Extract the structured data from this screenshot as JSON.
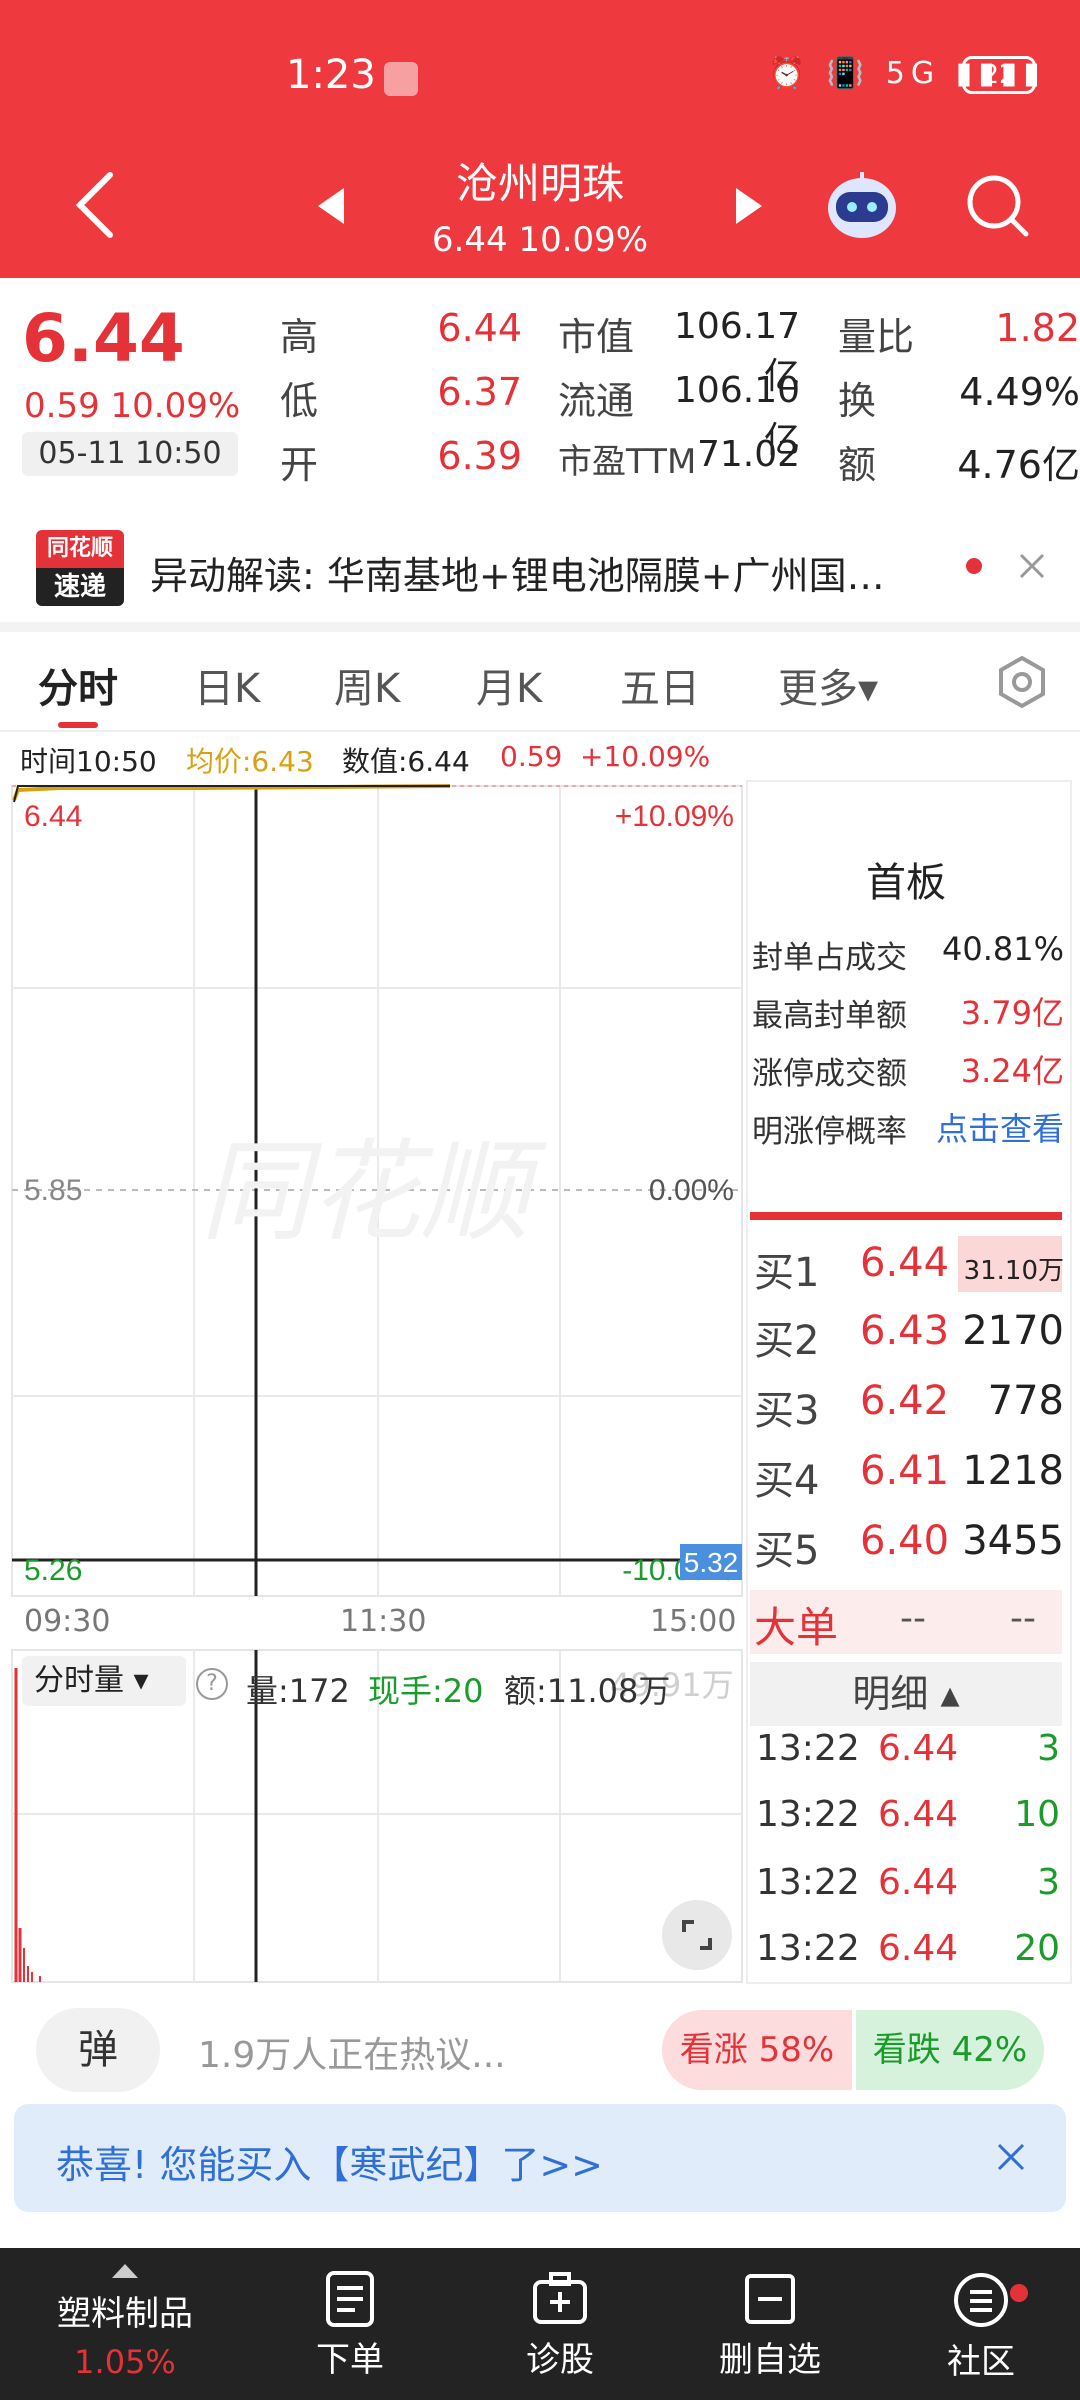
{
  "status_bar": {
    "time": "1:23",
    "icons": "⏰ 📳 5G ▮▮▮▮",
    "battery": "22"
  },
  "header": {
    "title": "沧州明珠",
    "subtitle": "6.44 10.09%"
  },
  "quote": {
    "price": "6.44",
    "change": "0.59  10.09%",
    "time": "05-11 10:50",
    "stats": [
      {
        "label": "高",
        "value": "6.44"
      },
      {
        "label": "低",
        "value": "6.37"
      },
      {
        "label": "开",
        "value": "6.39"
      },
      {
        "label": "市值",
        "value": "106.17亿"
      },
      {
        "label": "流通",
        "value": "106.10亿"
      },
      {
        "label": "市盈TTM",
        "value": "71.02"
      },
      {
        "label": "量比",
        "value": "1.82"
      },
      {
        "label": "换",
        "value": "4.49%"
      },
      {
        "label": "额",
        "value": "4.76亿"
      }
    ]
  },
  "news": {
    "logo_top": "同花顺",
    "logo_bottom": "速递",
    "text": "异动解读:  华南基地+锂电池隔膜+广州国…"
  },
  "tabs": [
    "分时",
    "日K",
    "周K",
    "月K",
    "五日",
    "更多▾"
  ],
  "chart_info": {
    "time": "时间10:50",
    "avg": "均价:6.43",
    "value": "数值:6.44",
    "chg": "0.59",
    "pct": "+10.09%"
  },
  "chart": {
    "y_top": "6.44",
    "y_mid": "5.85",
    "y_bot": "5.26",
    "pct_top": "+10.09%",
    "pct_mid": "0.00%",
    "pct_bot": "-10.09%",
    "price_marker": "5.32",
    "x_labels": [
      "09:30",
      "11:30",
      "15:00"
    ],
    "watermark": "同花顺"
  },
  "volume": {
    "selector": "分时量 ▾",
    "vol": "量:172",
    "now": "现手:20",
    "amt": "额:11.08万",
    "ghost": "49.91万"
  },
  "order_panel": {
    "title": "首板",
    "metrics": [
      {
        "label": "封单占成交",
        "value": "40.81%"
      },
      {
        "label": "最高封单额",
        "value": "3.79亿"
      },
      {
        "label": "涨停成交额",
        "value": "3.24亿"
      },
      {
        "label": "明涨停概率",
        "value": "点击查看"
      }
    ],
    "bids": [
      {
        "label": "买1",
        "price": "6.44",
        "vol": "31.10万"
      },
      {
        "label": "买2",
        "price": "6.43",
        "vol": "2170"
      },
      {
        "label": "买3",
        "price": "6.42",
        "vol": "778"
      },
      {
        "label": "买4",
        "price": "6.41",
        "vol": "1218"
      },
      {
        "label": "买5",
        "price": "6.40",
        "vol": "3455"
      }
    ],
    "big_order": {
      "label": "大单",
      "a": "--",
      "b": "--"
    },
    "detail_header": "明细 ▴",
    "ticks": [
      {
        "time": "13:22",
        "price": "6.44",
        "vol": "3"
      },
      {
        "time": "13:22",
        "price": "6.44",
        "vol": "10"
      },
      {
        "time": "13:22",
        "price": "6.44",
        "vol": "3"
      },
      {
        "time": "13:22",
        "price": "6.44",
        "vol": "20"
      }
    ]
  },
  "discussion": {
    "danmu": "弹",
    "text": "1.9万人正在热议...",
    "bull": "看涨 58%",
    "bear": "看跌 42%"
  },
  "promo": {
    "text": "恭喜!  您能买入【寒武纪】了>>"
  },
  "bottom_nav": [
    {
      "label": "塑料制品",
      "sub": "1.05%"
    },
    {
      "label": "下单"
    },
    {
      "label": "诊股"
    },
    {
      "label": "删自选"
    },
    {
      "label": "社区"
    }
  ],
  "colors": {
    "header": "#ee3a3f",
    "up": "#e53238",
    "down": "#1a9b2a",
    "avg_line": "#d9a012",
    "link": "#2f6fd6"
  }
}
